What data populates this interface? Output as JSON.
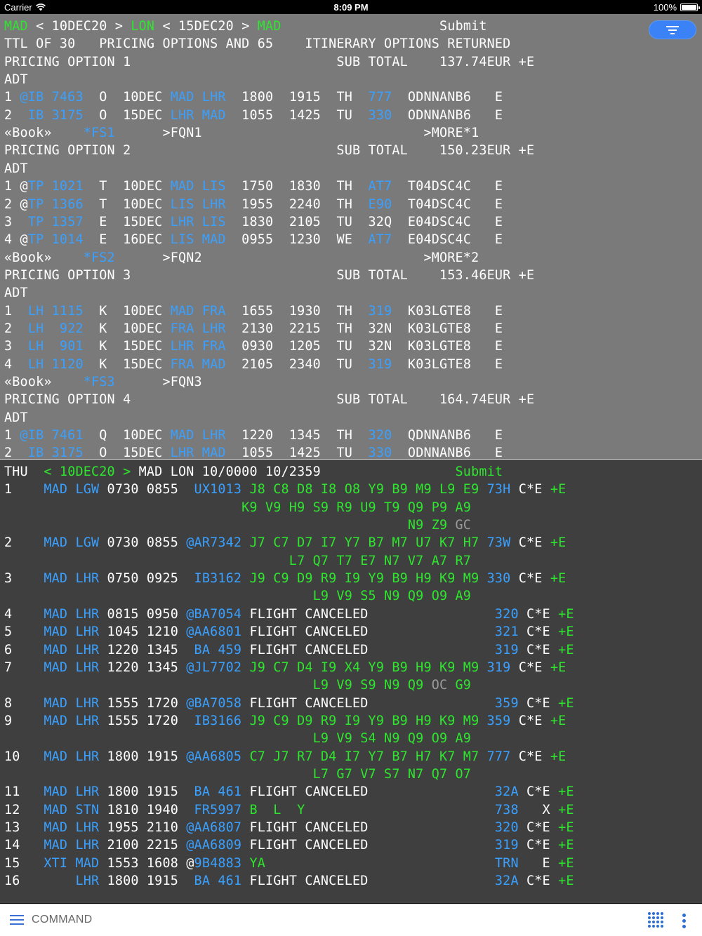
{
  "status_bar": {
    "carrier": "Carrier",
    "time": "8:09 PM",
    "battery": "100%"
  },
  "colors": {
    "white": "#ffffff",
    "blue": "#3aa0ff",
    "green": "#2ee62e",
    "gray": "#9a9a9a",
    "top_bg": "#7a7a7a",
    "bottom_bg": "#3f3f3f",
    "accent": "#3b82f6"
  },
  "pricing_panel": {
    "lines": [
      [
        [
          "g",
          "MAD"
        ],
        [
          "w",
          " < 10DEC20 > "
        ],
        [
          "g",
          "LON"
        ],
        [
          "w",
          " < 15DEC20 > "
        ],
        [
          "g",
          "MAD"
        ],
        [
          "w",
          "                    Submit"
        ]
      ],
      [
        [
          "w",
          "TTL OF 30   PRICING OPTIONS AND 65    ITINERARY OPTIONS RETURNED"
        ]
      ],
      [
        [
          "w",
          "PRICING OPTION 1                          SUB TOTAL    137.74EUR +E"
        ]
      ],
      [
        [
          "w",
          "ADT"
        ]
      ],
      [
        [
          "w",
          "1 "
        ],
        [
          "b",
          "@IB 7463"
        ],
        [
          "w",
          "  O  10DEC "
        ],
        [
          "b",
          "MAD LHR"
        ],
        [
          "w",
          "  1800  1915  TH  "
        ],
        [
          "b",
          "777"
        ],
        [
          "w",
          "  ODNNANB6   E"
        ]
      ],
      [
        [
          "w",
          "2  "
        ],
        [
          "b",
          "IB 3175"
        ],
        [
          "w",
          "  O  15DEC "
        ],
        [
          "b",
          "LHR MAD"
        ],
        [
          "w",
          "  1055  1425  TU  "
        ],
        [
          "b",
          "330"
        ],
        [
          "w",
          "  ODNNANB6   E"
        ]
      ],
      [
        [
          "w",
          "«Book»    "
        ],
        [
          "b",
          "*FS1"
        ],
        [
          "w",
          "      >FQN1                            >MORE*1"
        ]
      ],
      [
        [
          "w",
          "PRICING OPTION 2                          SUB TOTAL    150.23EUR +E"
        ]
      ],
      [
        [
          "w",
          "ADT"
        ]
      ],
      [
        [
          "w",
          "1 @"
        ],
        [
          "b",
          "TP 1021"
        ],
        [
          "w",
          "  T  10DEC "
        ],
        [
          "b",
          "MAD LIS"
        ],
        [
          "w",
          "  1750  1830  TH  "
        ],
        [
          "b",
          "AT7"
        ],
        [
          "w",
          "  T04DSC4C   E"
        ]
      ],
      [
        [
          "w",
          "2 @"
        ],
        [
          "b",
          "TP 1366"
        ],
        [
          "w",
          "  T  10DEC "
        ],
        [
          "b",
          "LIS LHR"
        ],
        [
          "w",
          "  1955  2240  TH  "
        ],
        [
          "b",
          "E90"
        ],
        [
          "w",
          "  T04DSC4C   E"
        ]
      ],
      [
        [
          "w",
          "3  "
        ],
        [
          "b",
          "TP 1357"
        ],
        [
          "w",
          "  E  15DEC "
        ],
        [
          "b",
          "LHR LIS"
        ],
        [
          "w",
          "  1830  2105  TU  32Q  E04DSC4C   E"
        ]
      ],
      [
        [
          "w",
          "4 @"
        ],
        [
          "b",
          "TP 1014"
        ],
        [
          "w",
          "  E  16DEC "
        ],
        [
          "b",
          "LIS MAD"
        ],
        [
          "w",
          "  0955  1230  WE  "
        ],
        [
          "b",
          "AT7"
        ],
        [
          "w",
          "  E04DSC4C   E"
        ]
      ],
      [
        [
          "w",
          "«Book»    "
        ],
        [
          "b",
          "*FS2"
        ],
        [
          "w",
          "      >FQN2                            >MORE*2"
        ]
      ],
      [
        [
          "w",
          "PRICING OPTION 3                          SUB TOTAL    153.46EUR +E"
        ]
      ],
      [
        [
          "w",
          "ADT"
        ]
      ],
      [
        [
          "w",
          "1  "
        ],
        [
          "b",
          "LH 1115"
        ],
        [
          "w",
          "  K  10DEC "
        ],
        [
          "b",
          "MAD FRA"
        ],
        [
          "w",
          "  1655  1930  TH  "
        ],
        [
          "b",
          "319"
        ],
        [
          "w",
          "  K03LGTE8   E"
        ]
      ],
      [
        [
          "w",
          "2  "
        ],
        [
          "b",
          "LH  922"
        ],
        [
          "w",
          "  K  10DEC "
        ],
        [
          "b",
          "FRA LHR"
        ],
        [
          "w",
          "  2130  2215  TH  32N  K03LGTE8   E"
        ]
      ],
      [
        [
          "w",
          "3  "
        ],
        [
          "b",
          "LH  901"
        ],
        [
          "w",
          "  K  15DEC "
        ],
        [
          "b",
          "LHR FRA"
        ],
        [
          "w",
          "  0930  1205  TU  32N  K03LGTE8   E"
        ]
      ],
      [
        [
          "w",
          "4  "
        ],
        [
          "b",
          "LH 1120"
        ],
        [
          "w",
          "  K  15DEC "
        ],
        [
          "b",
          "FRA MAD"
        ],
        [
          "w",
          "  2105  2340  TU  "
        ],
        [
          "b",
          "319"
        ],
        [
          "w",
          "  K03LGTE8   E"
        ]
      ],
      [
        [
          "w",
          "«Book»    "
        ],
        [
          "b",
          "*FS3"
        ],
        [
          "w",
          "      >FQN3"
        ]
      ],
      [
        [
          "w",
          "PRICING OPTION 4                          SUB TOTAL    164.74EUR +E"
        ]
      ],
      [
        [
          "w",
          "ADT"
        ]
      ],
      [
        [
          "w",
          "1 "
        ],
        [
          "b",
          "@IB 7461"
        ],
        [
          "w",
          "  Q  10DEC "
        ],
        [
          "b",
          "MAD LHR"
        ],
        [
          "w",
          "  1220  1345  TH  "
        ],
        [
          "b",
          "320"
        ],
        [
          "w",
          "  QDNNANB6   E"
        ]
      ],
      [
        [
          "w",
          "2  "
        ],
        [
          "b",
          "IB 3175"
        ],
        [
          "w",
          "  O  15DEC "
        ],
        [
          "b",
          "LHR MAD"
        ],
        [
          "w",
          "  1055  1425  TU  "
        ],
        [
          "b",
          "330"
        ],
        [
          "w",
          "  ODNNANB6   E"
        ]
      ]
    ]
  },
  "availability_panel": {
    "lines": [
      [
        [
          "w",
          "THU  "
        ],
        [
          "g",
          "< 10DEC20 > "
        ],
        [
          "w",
          "MAD LON 10/0000 10/2359                 "
        ],
        [
          "g",
          "Submit"
        ]
      ],
      [
        [
          "w",
          "1    "
        ],
        [
          "b",
          "MAD LGW"
        ],
        [
          "w",
          " 0730 0855  "
        ],
        [
          "b",
          "UX1013"
        ],
        [
          "g",
          " J8 C8 D8 I8 O8 Y9 B9 M9 L9 E9 "
        ],
        [
          "b",
          "73H"
        ],
        [
          "w",
          " C*E "
        ],
        [
          "g",
          "+E"
        ]
      ],
      [
        [
          "g",
          "                              K9 V9 H9 S9 R9 U9 T9 Q9 P9 A9"
        ]
      ],
      [
        [
          "g",
          "                                                   N9 Z9 "
        ],
        [
          "gr",
          "GC"
        ]
      ],
      [
        [
          "w",
          "2    "
        ],
        [
          "b",
          "MAD LGW"
        ],
        [
          "w",
          " 0730 0855 "
        ],
        [
          "b",
          "@AR7342"
        ],
        [
          "g",
          " J7 C7 D7 I7 Y7 B7 M7 U7 K7 H7 "
        ],
        [
          "b",
          "73W"
        ],
        [
          "w",
          " C*E "
        ],
        [
          "g",
          "+E"
        ]
      ],
      [
        [
          "g",
          "                                    L7 Q7 T7 E7 N7 V7 A7 R7"
        ]
      ],
      [
        [
          "w",
          "3    "
        ],
        [
          "b",
          "MAD LHR"
        ],
        [
          "w",
          " 0750 0925  "
        ],
        [
          "b",
          "IB3162"
        ],
        [
          "g",
          " J9 C9 D9 R9 I9 Y9 B9 H9 K9 M9 "
        ],
        [
          "b",
          "330"
        ],
        [
          "w",
          " C*E "
        ],
        [
          "g",
          "+E"
        ]
      ],
      [
        [
          "g",
          "                                       L9 V9 S5 N9 Q9 O9 A9"
        ]
      ],
      [
        [
          "w",
          "4    "
        ],
        [
          "b",
          "MAD LHR"
        ],
        [
          "w",
          " 0815 0950 "
        ],
        [
          "b",
          "@BA7054"
        ],
        [
          "w",
          " FLIGHT CANCELED                "
        ],
        [
          "b",
          "320"
        ],
        [
          "w",
          " C*E "
        ],
        [
          "g",
          "+E"
        ]
      ],
      [
        [
          "w",
          "5    "
        ],
        [
          "b",
          "MAD LHR"
        ],
        [
          "w",
          " 1045 1210 "
        ],
        [
          "b",
          "@AA6801"
        ],
        [
          "w",
          " FLIGHT CANCELED                "
        ],
        [
          "b",
          "321"
        ],
        [
          "w",
          " C*E "
        ],
        [
          "g",
          "+E"
        ]
      ],
      [
        [
          "w",
          "6    "
        ],
        [
          "b",
          "MAD LHR"
        ],
        [
          "w",
          " 1220 1345  "
        ],
        [
          "b",
          "BA 459"
        ],
        [
          "w",
          " FLIGHT CANCELED                "
        ],
        [
          "b",
          "319"
        ],
        [
          "w",
          " C*E "
        ],
        [
          "g",
          "+E"
        ]
      ],
      [
        [
          "w",
          "7    "
        ],
        [
          "b",
          "MAD LHR"
        ],
        [
          "w",
          " 1220 1345 "
        ],
        [
          "b",
          "@JL7702"
        ],
        [
          "g",
          " J9 C7 D4 I9 X4 Y9 B9 H9 K9 M9 "
        ],
        [
          "b",
          "319"
        ],
        [
          "w",
          " C*E "
        ],
        [
          "g",
          "+E"
        ]
      ],
      [
        [
          "g",
          "                                       L9 V9 S9 N9 Q9 "
        ],
        [
          "gr",
          "OC"
        ],
        [
          "g",
          " G9"
        ]
      ],
      [
        [
          "w",
          "8    "
        ],
        [
          "b",
          "MAD LHR"
        ],
        [
          "w",
          " 1555 1720 "
        ],
        [
          "b",
          "@BA7058"
        ],
        [
          "w",
          " FLIGHT CANCELED                "
        ],
        [
          "b",
          "359"
        ],
        [
          "w",
          " C*E "
        ],
        [
          "g",
          "+E"
        ]
      ],
      [
        [
          "w",
          "9    "
        ],
        [
          "b",
          "MAD LHR"
        ],
        [
          "w",
          " 1555 1720  "
        ],
        [
          "b",
          "IB3166"
        ],
        [
          "g",
          " J9 C9 D9 R9 I9 Y9 B9 H9 K9 M9 "
        ],
        [
          "b",
          "359"
        ],
        [
          "w",
          " C*E "
        ],
        [
          "g",
          "+E"
        ]
      ],
      [
        [
          "g",
          "                                       L9 V9 S4 N9 Q9 O9 A9"
        ]
      ],
      [
        [
          "w",
          "10   "
        ],
        [
          "b",
          "MAD LHR"
        ],
        [
          "w",
          " 1800 1915 "
        ],
        [
          "b",
          "@AA6805"
        ],
        [
          "g",
          " C7 J7 R7 D4 I7 Y7 B7 H7 K7 M7 "
        ],
        [
          "b",
          "777"
        ],
        [
          "w",
          " C*E "
        ],
        [
          "g",
          "+E"
        ]
      ],
      [
        [
          "g",
          "                                       L7 G7 V7 S7 N7 Q7 O7"
        ]
      ],
      [
        [
          "w",
          "11   "
        ],
        [
          "b",
          "MAD LHR"
        ],
        [
          "w",
          " 1800 1915  "
        ],
        [
          "b",
          "BA 461"
        ],
        [
          "w",
          " FLIGHT CANCELED                "
        ],
        [
          "b",
          "32A"
        ],
        [
          "w",
          " C*E "
        ],
        [
          "g",
          "+E"
        ]
      ],
      [
        [
          "w",
          "12   "
        ],
        [
          "b",
          "MAD STN"
        ],
        [
          "w",
          " 1810 1940  "
        ],
        [
          "b",
          "FR5997"
        ],
        [
          "g",
          " B  L  Y                        "
        ],
        [
          "b",
          "738"
        ],
        [
          "w",
          "   X "
        ],
        [
          "g",
          "+E"
        ]
      ],
      [
        [
          "w",
          "13   "
        ],
        [
          "b",
          "MAD LHR"
        ],
        [
          "w",
          " 1955 2110 "
        ],
        [
          "b",
          "@AA6807"
        ],
        [
          "w",
          " FLIGHT CANCELED                "
        ],
        [
          "b",
          "320"
        ],
        [
          "w",
          " C*E "
        ],
        [
          "g",
          "+E"
        ]
      ],
      [
        [
          "w",
          "14   "
        ],
        [
          "b",
          "MAD LHR"
        ],
        [
          "w",
          " 2100 2215 "
        ],
        [
          "b",
          "@AA6809"
        ],
        [
          "w",
          " FLIGHT CANCELED                "
        ],
        [
          "b",
          "319"
        ],
        [
          "w",
          " C*E "
        ],
        [
          "g",
          "+E"
        ]
      ],
      [
        [
          "w",
          "15   "
        ],
        [
          "b",
          "XTI MAD"
        ],
        [
          "w",
          " 1553 1608 @"
        ],
        [
          "b",
          "9B4883"
        ],
        [
          "g",
          " YA                             "
        ],
        [
          "b",
          "TRN"
        ],
        [
          "w",
          "   E "
        ],
        [
          "g",
          "+E"
        ]
      ],
      [
        [
          "w",
          "16   "
        ],
        [
          "b",
          "    LHR"
        ],
        [
          "w",
          " 1800 1915  "
        ],
        [
          "b",
          "BA 461"
        ],
        [
          "w",
          " FLIGHT CANCELED                "
        ],
        [
          "b",
          "32A"
        ],
        [
          "w",
          " C*E "
        ],
        [
          "g",
          "+E"
        ]
      ]
    ]
  },
  "command_bar": {
    "label": "COMMAND"
  },
  "icons": {
    "wifi": "wifi-icon",
    "battery": "battery-icon",
    "filter": "filter-icon",
    "menu": "menu-icon",
    "keypad": "keypad-icon",
    "more": "more-vertical-icon"
  }
}
